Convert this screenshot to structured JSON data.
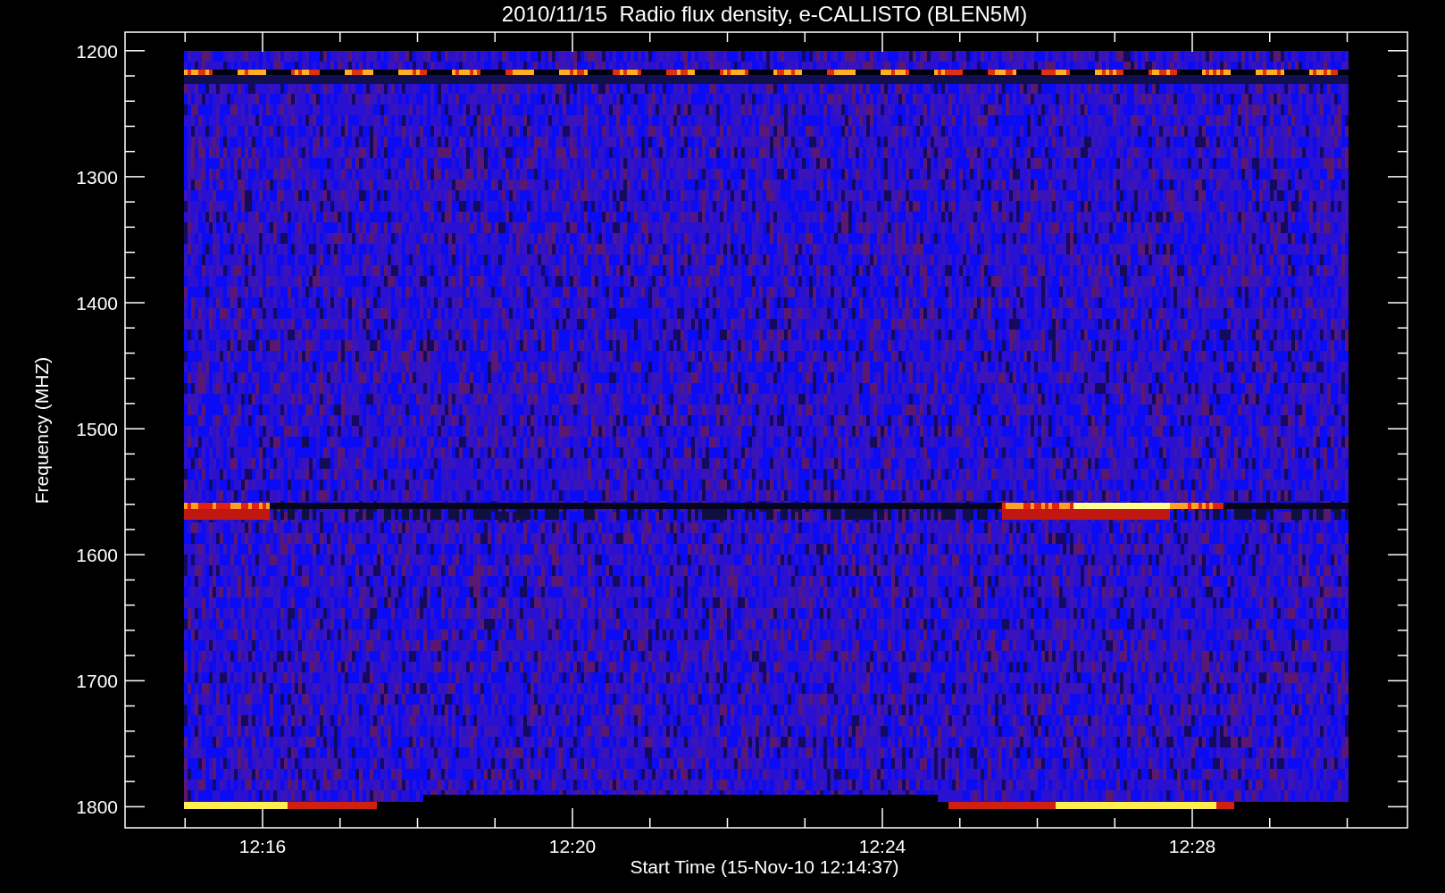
{
  "title": "2010/11/15  Radio flux density, e-CALLISTO (BLEN5M)",
  "y_axis": {
    "label": "Frequency (MHZ)",
    "ticks": [
      "1200",
      "1300",
      "1400",
      "1500",
      "1600",
      "1700",
      "1800"
    ]
  },
  "x_axis": {
    "label": "Start Time (15-Nov-10 12:14:37)",
    "ticks": [
      "12:16",
      "12:20",
      "12:24",
      "12:28"
    ]
  }
}
